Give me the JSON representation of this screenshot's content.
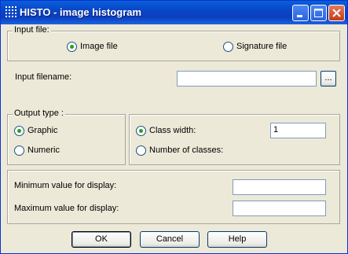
{
  "window": {
    "title": "HISTO - image histogram"
  },
  "input_file": {
    "group_label": "Input file:",
    "options": [
      {
        "label": "Image file",
        "selected": true
      },
      {
        "label": "Signature file",
        "selected": false
      }
    ],
    "filename_label": "Input filename:",
    "filename_value": "",
    "browse_label": "..."
  },
  "output_type": {
    "group_label": "Output type :",
    "options": [
      {
        "label": "Graphic",
        "selected": true
      },
      {
        "label": "Numeric",
        "selected": false
      }
    ]
  },
  "classes": {
    "options": [
      {
        "label": "Class width:",
        "selected": true
      },
      {
        "label": "Number of classes:",
        "selected": false
      }
    ],
    "class_width_value": "1"
  },
  "display": {
    "min_label": "Minimum value for display:",
    "min_value": "",
    "max_label": "Maximum value for display:",
    "max_value": ""
  },
  "buttons": {
    "ok": "OK",
    "cancel": "Cancel",
    "help": "Help"
  },
  "colors": {
    "titlebar": "#0a3fbe",
    "face": "#ece9d8",
    "radio_dot": "#21a121"
  }
}
